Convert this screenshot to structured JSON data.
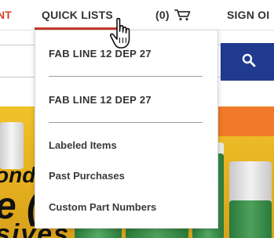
{
  "nav": {
    "left_partial": "NT",
    "quick_lists": "QUICK LISTS",
    "cart_count": "(0)",
    "sign_partial": "SIGN OI",
    "accent_color": "#c8392b"
  },
  "search": {
    "placeholder": "",
    "button_icon": "search-icon",
    "button_color": "#1f3a8f"
  },
  "dropdown": {
    "lists": [
      {
        "label": "FAB LINE 12 DEP 27"
      },
      {
        "label": "FAB LINE 12 DEP 27"
      }
    ],
    "links": [
      {
        "label": "Labeled Items"
      },
      {
        "label": "Past Purchases"
      },
      {
        "label": "Custom Part Numbers"
      }
    ]
  },
  "hero": {
    "text_line1": "ond",
    "text_line2": "e (",
    "text_line3": "sives"
  }
}
